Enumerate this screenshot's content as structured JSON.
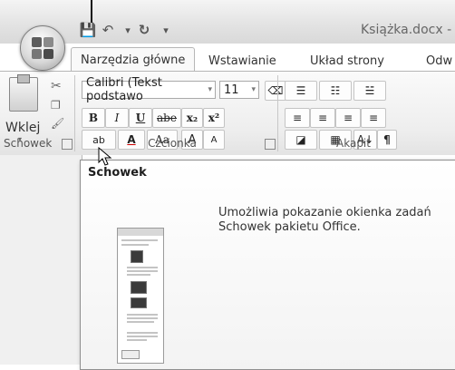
{
  "app": {
    "document_title": "Książka.docx -"
  },
  "quick_access": {
    "icons": [
      "save-icon",
      "undo-icon",
      "redo-icon",
      "customize-icon"
    ]
  },
  "tabs": [
    {
      "label": "Narzędzia główne",
      "active": true
    },
    {
      "label": "Wstawianie",
      "active": false
    },
    {
      "label": "Układ strony",
      "active": false
    },
    {
      "label": "Odw",
      "active": false
    }
  ],
  "ribbon": {
    "clipboard": {
      "paste_label": "Wklej",
      "group_label": "Schowek"
    },
    "font": {
      "font_name": "Calibri (Tekst podstawo",
      "font_size": "11",
      "bold": "B",
      "italic": "I",
      "underline": "U",
      "strike": "abe",
      "subscript": "x₂",
      "superscript": "x²",
      "highlight": "ab",
      "font_color": "A",
      "change_case": "Aa",
      "grow": "A",
      "shrink": "A",
      "group_label": "Czcionka"
    },
    "paragraph": {
      "sort": "A↓",
      "group_label": "Akapit"
    }
  },
  "tooltip": {
    "title": "Schowek",
    "description": "Umożliwia pokazanie okienka zadań Schowek pakietu Office."
  }
}
